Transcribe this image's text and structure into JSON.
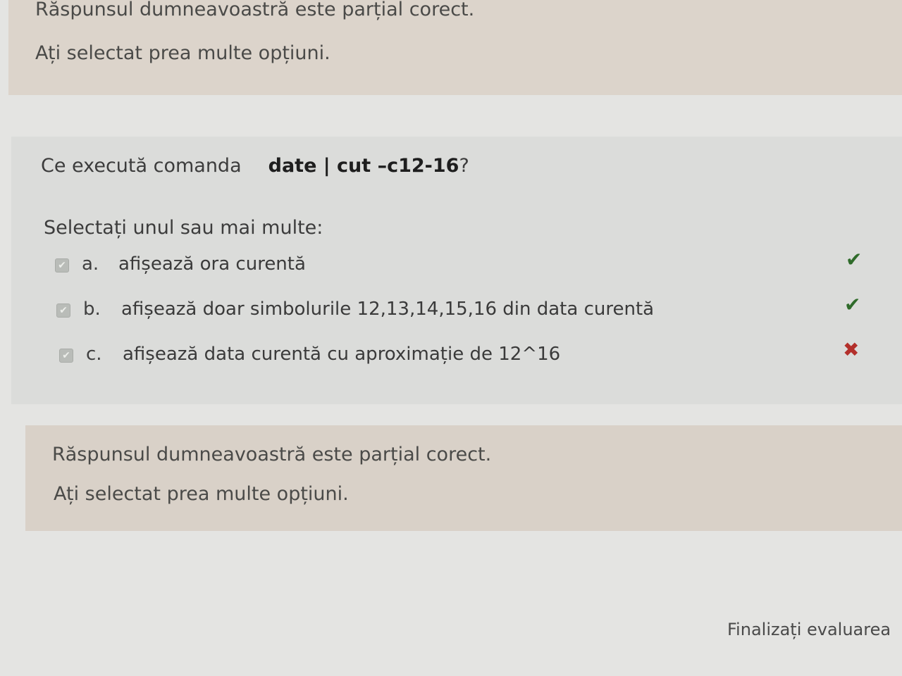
{
  "feedback_top": {
    "line1": "Răspunsul dumneavoastră este parțial corect.",
    "line2": "Ați selectat prea multe opțiuni."
  },
  "question": {
    "prompt_prefix": "Ce execută comanda",
    "command": "date | cut –c12-16",
    "prompt_suffix": "?",
    "instruction": "Selectați unul sau mai multe:",
    "options": [
      {
        "letter": "a.",
        "text": "afișează ora curentă",
        "checked": true,
        "result": "correct",
        "result_icon": "check-icon",
        "result_color": "#2f6b2a"
      },
      {
        "letter": "b.",
        "text": "afișează doar simbolurile 12,13,14,15,16 din data curentă",
        "checked": true,
        "result": "correct",
        "result_icon": "check-icon",
        "result_color": "#2f6b2a"
      },
      {
        "letter": "c.",
        "text": "afișează data curentă cu aproximație de 12^16",
        "checked": true,
        "result": "incorrect",
        "result_icon": "cross-icon",
        "result_color": "#b3302b"
      }
    ]
  },
  "feedback_bottom": {
    "line1": "Răspunsul dumneavoastră este parțial corect.",
    "line2": "Ați selectat prea multe opțiuni."
  },
  "footer": {
    "finish_label": "Finalizați evaluarea"
  },
  "colors": {
    "page_bg": "#e4e4e2",
    "feedback_bg": "#dcd4cb",
    "question_bg": "#dbdcda",
    "correct": "#2f6b2a",
    "incorrect": "#b3302b"
  }
}
